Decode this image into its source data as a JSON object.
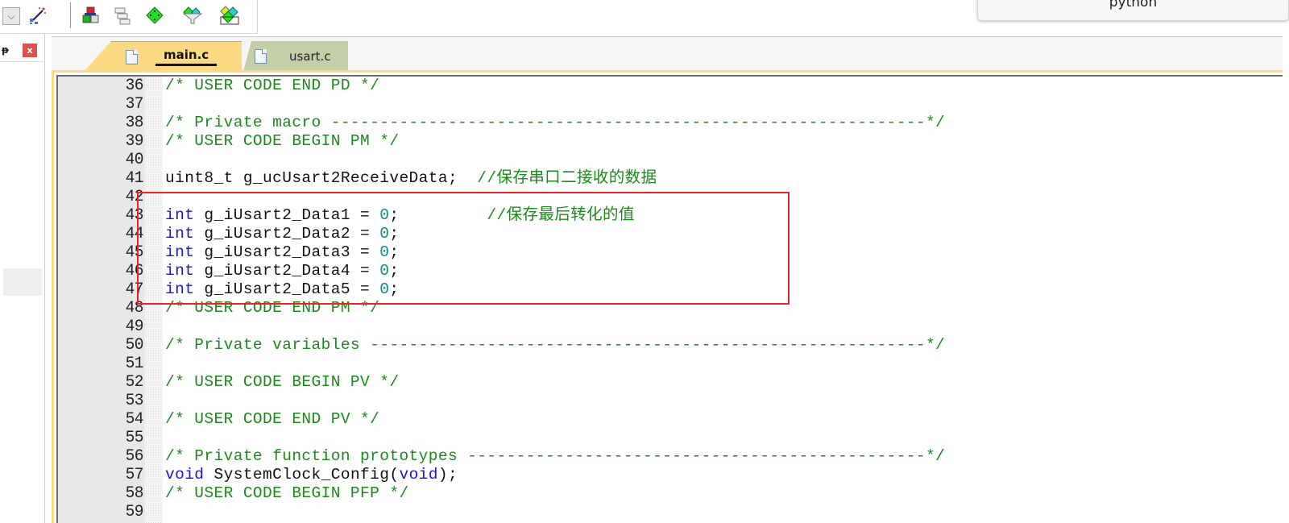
{
  "toolbar": {
    "dropdown_icon": "chevron-down-icon",
    "buttons": [
      {
        "name": "wizard-icon",
        "glyph": "✨"
      },
      {
        "name": "manage-project-items-icon",
        "glyph": "▦"
      },
      {
        "name": "windows-icon",
        "glyph": "⧉"
      },
      {
        "name": "green-diamond-icon",
        "glyph": "◆"
      },
      {
        "name": "funnel-icon",
        "glyph": "▼"
      },
      {
        "name": "multi-pack-icon",
        "glyph": "◈"
      }
    ]
  },
  "popup": {
    "text": "python"
  },
  "left_panel": {
    "pin_glyph": "ᵽ",
    "close_glyph": "x"
  },
  "tabs": [
    {
      "label": "main.c",
      "active": true
    },
    {
      "label": "usart.c",
      "active": false
    }
  ],
  "colors": {
    "comment": "#1b8a1b",
    "keyword": "#1616d6",
    "number": "#0b8a8a",
    "highlight_box": "#e8232a",
    "active_tab": "#fcd983",
    "inactive_tab": "#c3cfa6"
  },
  "editor": {
    "lines": [
      {
        "n": "36",
        "segs": [
          {
            "t": "/* USER CODE END PD */",
            "c": "comment"
          }
        ]
      },
      {
        "n": "37",
        "segs": []
      },
      {
        "n": "38",
        "segs": [
          {
            "t": "/* Private macro -------------------------------------------------------------*/",
            "c": "comment"
          }
        ]
      },
      {
        "n": "39",
        "segs": [
          {
            "t": "/* USER CODE BEGIN PM */",
            "c": "comment"
          }
        ]
      },
      {
        "n": "40",
        "segs": []
      },
      {
        "n": "41",
        "segs": [
          {
            "t": "uint8_t g_ucUsart2ReceiveData;  ",
            "c": "plain"
          },
          {
            "t": "//保存串口二接收的数据",
            "c": "comment"
          }
        ]
      },
      {
        "n": "42",
        "segs": []
      },
      {
        "n": "43",
        "segs": [
          {
            "t": "int",
            "c": "kw"
          },
          {
            "t": " g_iUsart2_Data1 = ",
            "c": "plain"
          },
          {
            "t": "0",
            "c": "num"
          },
          {
            "t": ";         ",
            "c": "plain"
          },
          {
            "t": "//保存最后转化的值",
            "c": "comment"
          }
        ]
      },
      {
        "n": "44",
        "segs": [
          {
            "t": "int",
            "c": "kw"
          },
          {
            "t": " g_iUsart2_Data2 = ",
            "c": "plain"
          },
          {
            "t": "0",
            "c": "num"
          },
          {
            "t": ";",
            "c": "plain"
          }
        ]
      },
      {
        "n": "45",
        "segs": [
          {
            "t": "int",
            "c": "kw"
          },
          {
            "t": " g_iUsart2_Data3 = ",
            "c": "plain"
          },
          {
            "t": "0",
            "c": "num"
          },
          {
            "t": ";",
            "c": "plain"
          }
        ]
      },
      {
        "n": "46",
        "segs": [
          {
            "t": "int",
            "c": "kw"
          },
          {
            "t": " g_iUsart2_Data4 = ",
            "c": "plain"
          },
          {
            "t": "0",
            "c": "num"
          },
          {
            "t": ";",
            "c": "plain"
          }
        ]
      },
      {
        "n": "47",
        "segs": [
          {
            "t": "int",
            "c": "kw"
          },
          {
            "t": " g_iUsart2_Data5 = ",
            "c": "plain"
          },
          {
            "t": "0",
            "c": "num"
          },
          {
            "t": ";",
            "c": "plain"
          }
        ]
      },
      {
        "n": "48",
        "segs": [
          {
            "t": "/* USER CODE END PM */",
            "c": "comment"
          }
        ]
      },
      {
        "n": "49",
        "segs": []
      },
      {
        "n": "50",
        "segs": [
          {
            "t": "/* Private variables ---------------------------------------------------------*/",
            "c": "comment"
          }
        ]
      },
      {
        "n": "51",
        "segs": []
      },
      {
        "n": "52",
        "segs": [
          {
            "t": "/* USER CODE BEGIN PV */",
            "c": "comment"
          }
        ]
      },
      {
        "n": "53",
        "segs": []
      },
      {
        "n": "54",
        "segs": [
          {
            "t": "/* USER CODE END PV */",
            "c": "comment"
          }
        ]
      },
      {
        "n": "55",
        "segs": []
      },
      {
        "n": "56",
        "segs": [
          {
            "t": "/* Private function prototypes -----------------------------------------------*/",
            "c": "comment"
          }
        ]
      },
      {
        "n": "57",
        "segs": [
          {
            "t": "void",
            "c": "kw"
          },
          {
            "t": " SystemClock_Config(",
            "c": "plain"
          },
          {
            "t": "void",
            "c": "kw"
          },
          {
            "t": ");",
            "c": "plain"
          }
        ]
      },
      {
        "n": "58",
        "segs": [
          {
            "t": "/* USER CODE BEGIN PFP */",
            "c": "comment"
          }
        ]
      },
      {
        "n": "59",
        "segs": []
      }
    ]
  }
}
